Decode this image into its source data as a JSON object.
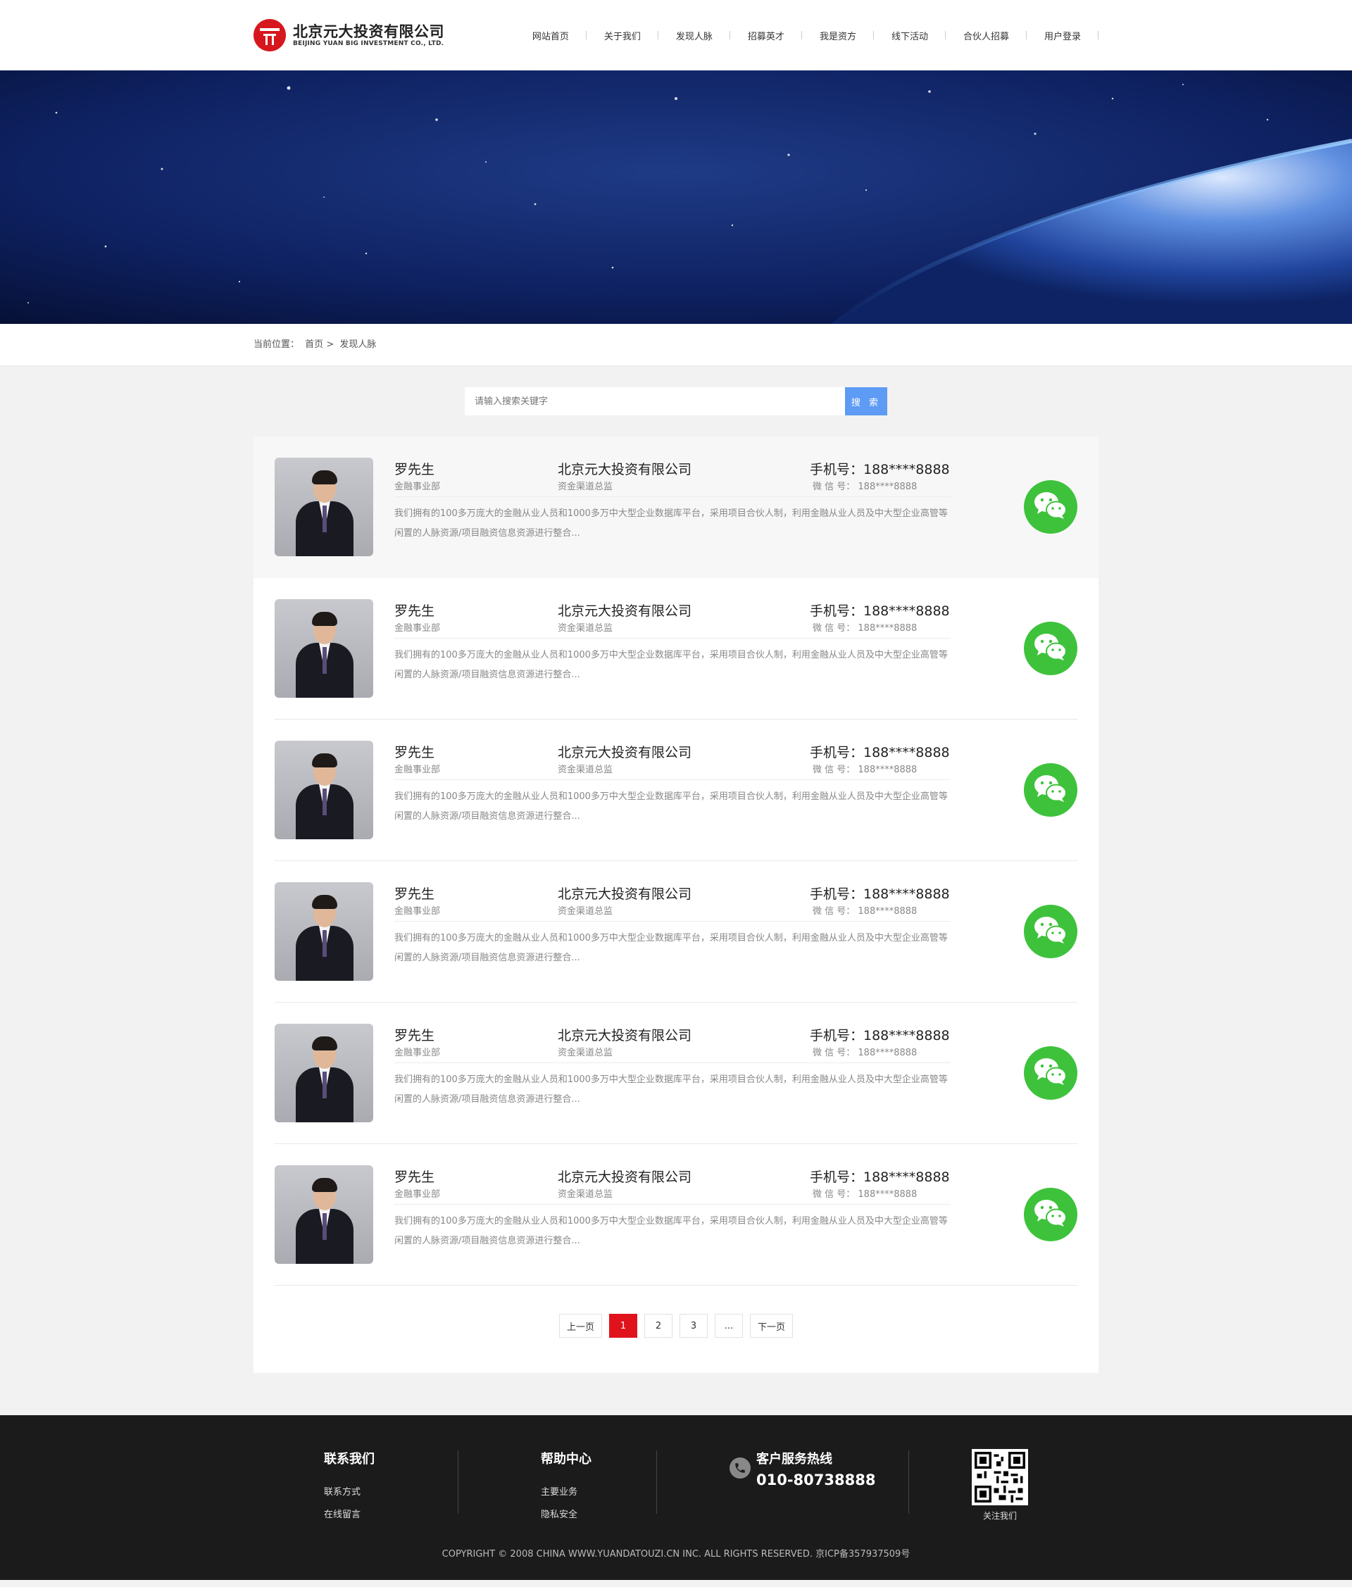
{
  "header": {
    "logo_cn": "北京元大投资有限公司",
    "logo_en": "BEIJING YUAN BIG INVESTMENT CO., LTD.",
    "nav": [
      "网站首页",
      "关于我们",
      "发现人脉",
      "招募英才",
      "我是资方",
      "线下活动",
      "合伙人招募",
      "用户登录"
    ]
  },
  "breadcrumb": {
    "label": "当前位置：",
    "home": "首页",
    "sep": ">",
    "current": "发现人脉"
  },
  "search": {
    "placeholder": "请输入搜索关键字",
    "button": "搜 索"
  },
  "contacts": [
    {
      "name": "罗先生",
      "dept": "金融事业部",
      "company": "北京元大投资有限公司",
      "title": "资金渠道总监",
      "phone": "手机号：188****8888",
      "wechat": "微 信 号： 188****8888",
      "desc": "我们拥有的100多万庞大的金融从业人员和1000多万中大型企业数据库平台，采用项目合伙人制，利用金融从业人员及中大型企业高管等闲置的人脉资源/项目融资信息资源进行整合..."
    },
    {
      "name": "罗先生",
      "dept": "金融事业部",
      "company": "北京元大投资有限公司",
      "title": "资金渠道总监",
      "phone": "手机号：188****8888",
      "wechat": "微 信 号： 188****8888",
      "desc": "我们拥有的100多万庞大的金融从业人员和1000多万中大型企业数据库平台，采用项目合伙人制，利用金融从业人员及中大型企业高管等闲置的人脉资源/项目融资信息资源进行整合..."
    },
    {
      "name": "罗先生",
      "dept": "金融事业部",
      "company": "北京元大投资有限公司",
      "title": "资金渠道总监",
      "phone": "手机号：188****8888",
      "wechat": "微 信 号： 188****8888",
      "desc": "我们拥有的100多万庞大的金融从业人员和1000多万中大型企业数据库平台，采用项目合伙人制，利用金融从业人员及中大型企业高管等闲置的人脉资源/项目融资信息资源进行整合..."
    },
    {
      "name": "罗先生",
      "dept": "金融事业部",
      "company": "北京元大投资有限公司",
      "title": "资金渠道总监",
      "phone": "手机号：188****8888",
      "wechat": "微 信 号： 188****8888",
      "desc": "我们拥有的100多万庞大的金融从业人员和1000多万中大型企业数据库平台，采用项目合伙人制，利用金融从业人员及中大型企业高管等闲置的人脉资源/项目融资信息资源进行整合..."
    },
    {
      "name": "罗先生",
      "dept": "金融事业部",
      "company": "北京元大投资有限公司",
      "title": "资金渠道总监",
      "phone": "手机号：188****8888",
      "wechat": "微 信 号： 188****8888",
      "desc": "我们拥有的100多万庞大的金融从业人员和1000多万中大型企业数据库平台，采用项目合伙人制，利用金融从业人员及中大型企业高管等闲置的人脉资源/项目融资信息资源进行整合..."
    },
    {
      "name": "罗先生",
      "dept": "金融事业部",
      "company": "北京元大投资有限公司",
      "title": "资金渠道总监",
      "phone": "手机号：188****8888",
      "wechat": "微 信 号： 188****8888",
      "desc": "我们拥有的100多万庞大的金融从业人员和1000多万中大型企业数据库平台，采用项目合伙人制，利用金融从业人员及中大型企业高管等闲置的人脉资源/项目融资信息资源进行整合..."
    }
  ],
  "pagination": {
    "prev": "上一页",
    "pages": [
      "1",
      "2",
      "3"
    ],
    "current": "1",
    "ellipsis": "...",
    "next": "下一页"
  },
  "footer": {
    "contact": {
      "title": "联系我们",
      "links": [
        "联系方式",
        "在线留言"
      ]
    },
    "help": {
      "title": "帮助中心",
      "links": [
        "主要业务",
        "隐私安全"
      ]
    },
    "hotline": {
      "title": "客户服务热线",
      "number": "010-80738888"
    },
    "qr_label": "关注我们",
    "copyright": "COPYRIGHT © 2008 CHINA WWW.YUANDATOUZI.CN INC. ALL RIGHTS RESERVED. 京ICP备357937509号"
  },
  "colors": {
    "brand_red": "#d7171e",
    "search_blue": "#5e9bf4",
    "wechat_green": "#3ec23c",
    "footer_bg": "#1b1b1b"
  }
}
